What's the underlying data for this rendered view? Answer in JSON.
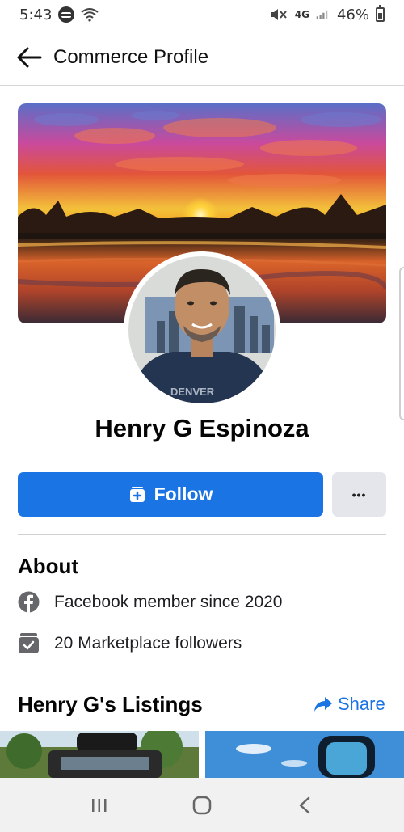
{
  "status_bar": {
    "time": "5:43",
    "network": "4G",
    "battery": "46%"
  },
  "header": {
    "title": "Commerce Profile"
  },
  "profile": {
    "name": "Henry G Espinoza",
    "shirt_text": "DENVER"
  },
  "actions": {
    "follow_label": "Follow",
    "more_label": "•••"
  },
  "about": {
    "title": "About",
    "items": [
      {
        "icon": "facebook-icon",
        "text": "Facebook member since 2020"
      },
      {
        "icon": "marketplace-followers-icon",
        "text": "20 Marketplace followers"
      }
    ]
  },
  "listings": {
    "title": "Henry G's Listings",
    "share_label": "Share"
  },
  "colors": {
    "primary": "#1b74e4",
    "secondary_button": "#e4e6eb",
    "icon_gray": "#65676b"
  }
}
